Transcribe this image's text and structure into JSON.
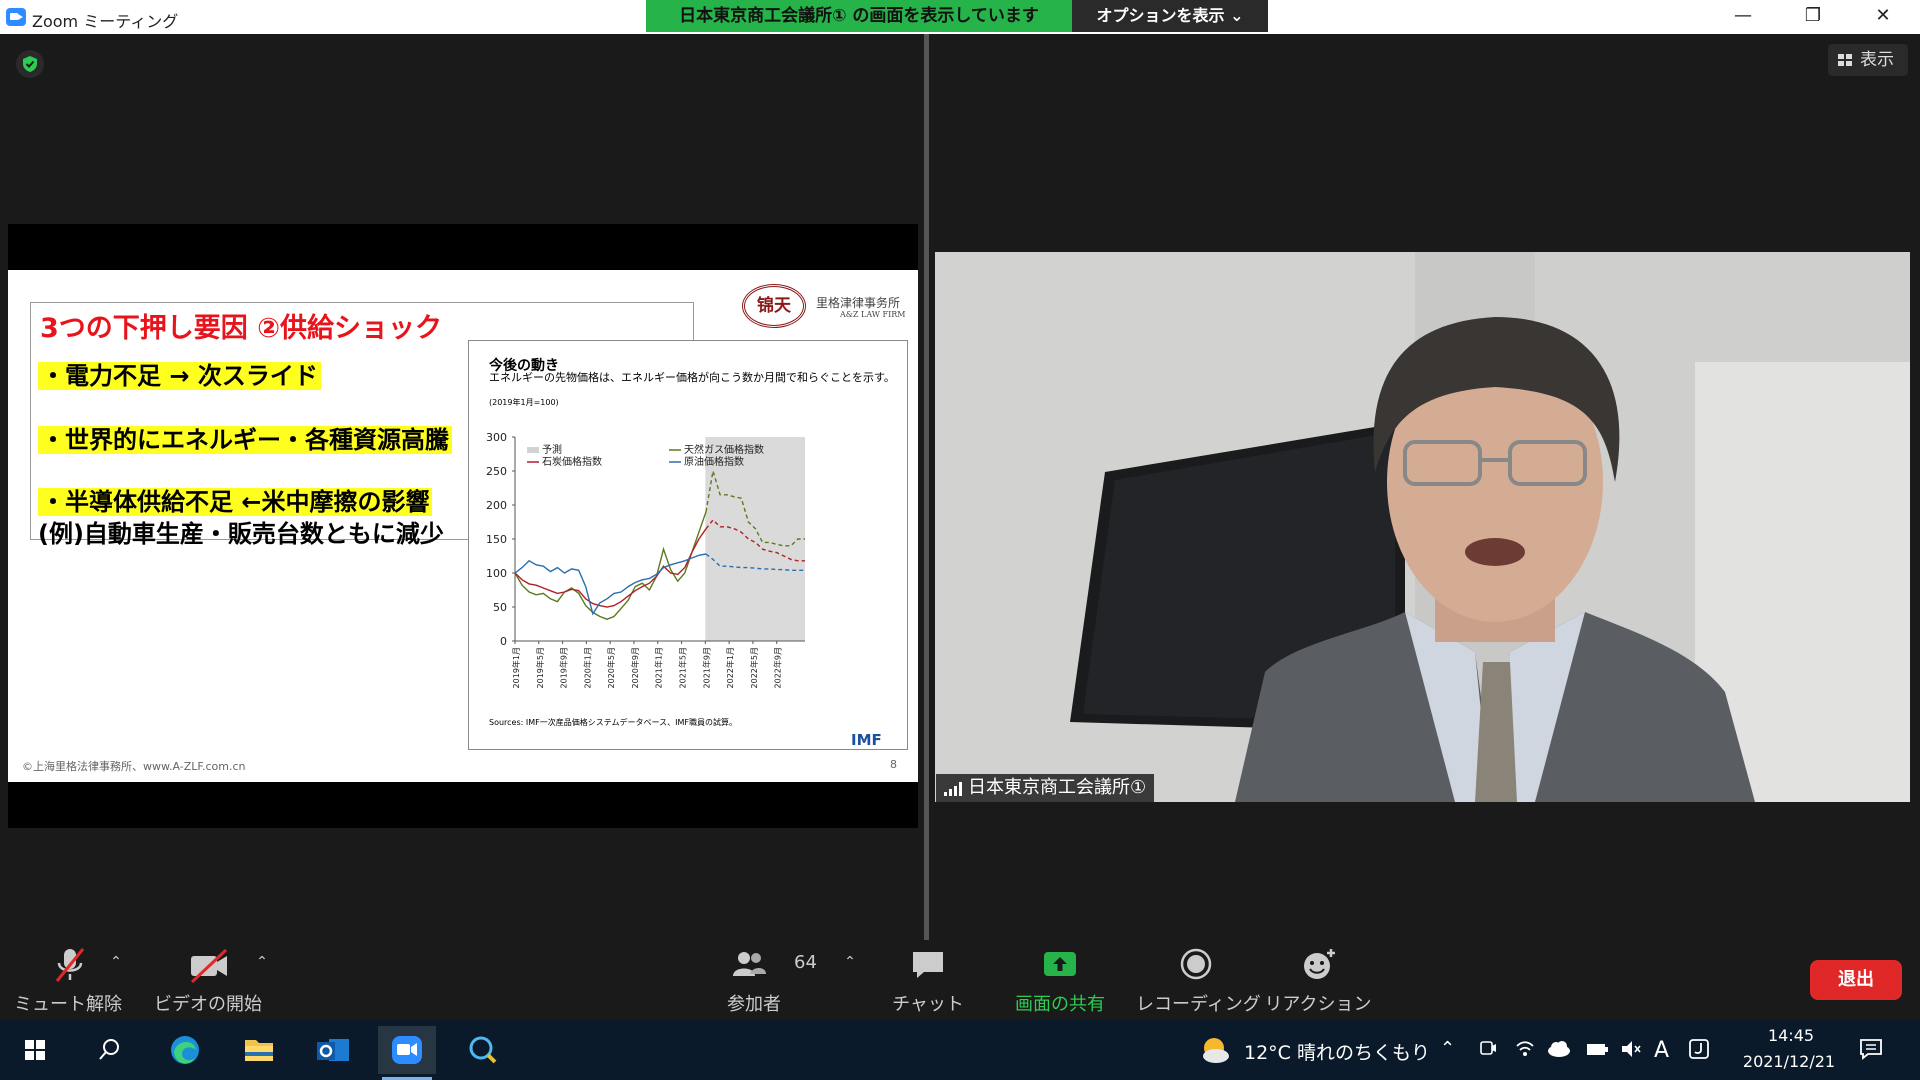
{
  "window": {
    "app_title": "Zoom ミーティング",
    "share_banner": "日本東京商工会議所① の画面を表示しています",
    "options_label": "オプションを表示 ⌄",
    "minimize": "—",
    "restore": "❐",
    "close": "✕"
  },
  "view_button": {
    "label": "表示"
  },
  "slide": {
    "title": "3つの下押し要因  ②供給ショック",
    "bullets": [
      "・電力不足  →  次スライド",
      "・世界的にエネルギー・各種資源高騰",
      "・半導体供給不足  ←米中摩擦の影響"
    ],
    "example": "(例)自動車生産・販売台数ともに減少",
    "firm_seal": "锦天",
    "firm_name_jp": "里格津律事务所",
    "firm_name_en": "A&Z LAW FIRM",
    "footer": "©上海里格法律事務所、www.A-ZLF.com.cn",
    "page_number": "8"
  },
  "imf_panel": {
    "title": "今後の動き",
    "subtitle": "エネルギーの先物価格は、エネルギー価格が向こう数か月間で和らぐことを示す。",
    "note": "(2019年1月=100)",
    "sources": "Sources: IMF一次産品価格システムデータベース、IMF職員の試算。",
    "brand": "IMF"
  },
  "chart_data": {
    "type": "line",
    "title": "今後の動き",
    "ylim": [
      0,
      300
    ],
    "yticks": [
      0,
      50,
      100,
      150,
      200,
      250,
      300
    ],
    "xticks": [
      "2019年1月",
      "2019年5月",
      "2019年9月",
      "2020年1月",
      "2020年5月",
      "2020年9月",
      "2021年1月",
      "2021年5月",
      "2021年9月",
      "2022年1月",
      "2022年5月",
      "2022年9月"
    ],
    "forecast_start": "2021年9月",
    "legend": [
      {
        "name": "予測",
        "color": "#d3d3d3"
      },
      {
        "name": "天然ガス価格指数",
        "color": "#5b7a1e"
      },
      {
        "name": "石炭価格指数",
        "color": "#b0202a"
      },
      {
        "name": "原油価格指数",
        "color": "#2a6fb0"
      }
    ],
    "series": [
      {
        "name": "天然ガス価格指数",
        "color": "#5b7a1e",
        "values": [
          100,
          82,
          72,
          68,
          70,
          62,
          58,
          72,
          78,
          70,
          52,
          42,
          36,
          32,
          36,
          48,
          60,
          80,
          85,
          75,
          95,
          135,
          105,
          88,
          100,
          130,
          160,
          190,
          250,
          215,
          215,
          212,
          210,
          175,
          165,
          145,
          145,
          142,
          140,
          140,
          150,
          150
        ]
      },
      {
        "name": "石炭価格指数",
        "color": "#b0202a",
        "values": [
          100,
          90,
          84,
          82,
          78,
          74,
          70,
          72,
          76,
          74,
          62,
          55,
          52,
          50,
          52,
          58,
          66,
          74,
          80,
          85,
          95,
          110,
          100,
          98,
          108,
          130,
          150,
          165,
          178,
          168,
          168,
          165,
          160,
          150,
          145,
          135,
          132,
          130,
          125,
          120,
          118,
          118
        ]
      },
      {
        "name": "原油価格指数",
        "color": "#2a6fb0",
        "values": [
          100,
          108,
          118,
          112,
          110,
          102,
          108,
          100,
          106,
          104,
          80,
          40,
          56,
          62,
          70,
          72,
          80,
          86,
          90,
          92,
          98,
          108,
          112,
          115,
          118,
          122,
          126,
          128,
          120,
          110,
          110,
          109,
          108,
          108,
          107,
          106,
          106,
          105,
          105,
          104,
          104,
          104
        ],
        "forecast_style": "dashed"
      }
    ]
  },
  "participant": {
    "name": "日本東京商工会議所①"
  },
  "toolbar": {
    "mute": "ミュート解除",
    "video": "ビデオの開始",
    "participants": "参加者",
    "participants_count": "64",
    "chat": "チャット",
    "share": "画面の共有",
    "record": "レコーディング",
    "reactions": "リアクション",
    "leave": "退出"
  },
  "taskbar": {
    "weather": "12°C  晴れのちくもり",
    "ime": "A",
    "time": "14:45",
    "date": "2021/12/21"
  },
  "colors": {
    "share_banner": "#26b34a",
    "leave": "#e02828",
    "slide_title": "#e8141b",
    "highlight": "#ffff1f",
    "imf_brand": "#1c4fa0"
  }
}
